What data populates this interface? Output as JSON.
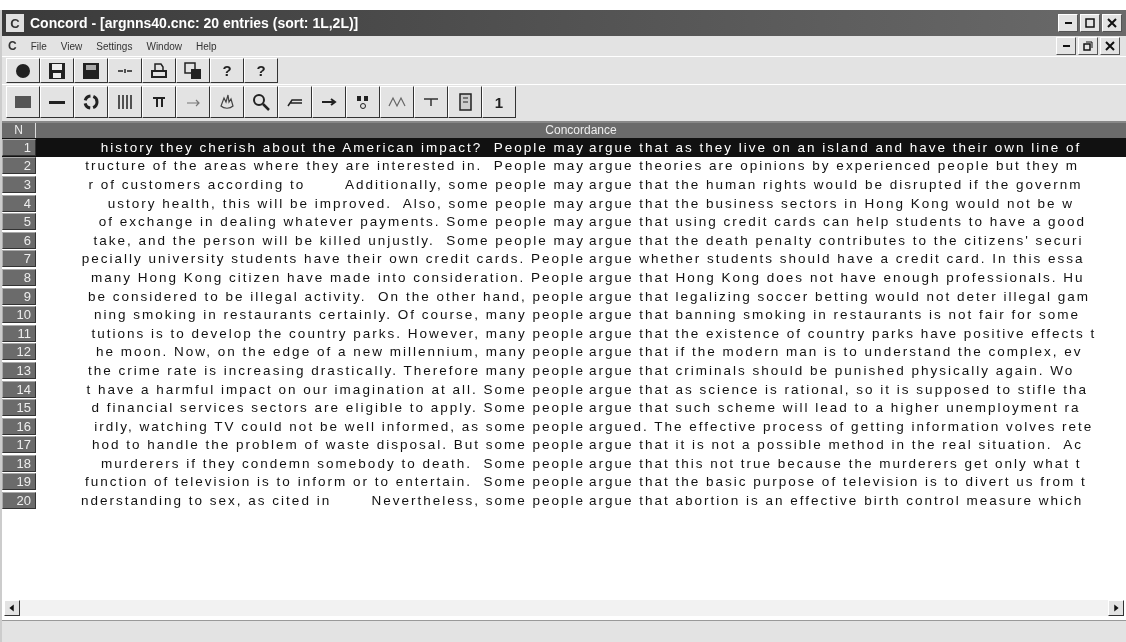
{
  "window": {
    "title": "Concord - [argnns40.cnc: 20 entries (sort: 1L,2L)]",
    "app_icon": "C"
  },
  "menu": {
    "system_icon": "C",
    "items": [
      "File",
      "View",
      "Settings",
      "Window",
      "Help"
    ]
  },
  "toolbars": [
    [
      {
        "kind": "icon"
      },
      {
        "kind": "icon"
      },
      {
        "kind": "icon"
      },
      {
        "kind": "icon"
      },
      {
        "kind": "icon"
      },
      {
        "kind": "icon"
      },
      {
        "kind": "text",
        "label": "?"
      },
      {
        "kind": "text",
        "label": "?"
      }
    ],
    [
      {
        "kind": "icon"
      },
      {
        "kind": "icon"
      },
      {
        "kind": "icon"
      },
      {
        "kind": "icon"
      },
      {
        "kind": "icon"
      },
      {
        "kind": "icon"
      },
      {
        "kind": "icon"
      },
      {
        "kind": "icon"
      },
      {
        "kind": "icon"
      },
      {
        "kind": "icon"
      },
      {
        "kind": "icon"
      },
      {
        "kind": "icon"
      },
      {
        "kind": "icon"
      },
      {
        "kind": "icon"
      },
      {
        "kind": "text",
        "label": "1"
      }
    ]
  ],
  "table": {
    "columns": [
      "N",
      "Concordance"
    ],
    "rows": [
      {
        "n": "1",
        "left": "history they cherish about the American impact?  People may",
        "right": "argue that as they live on an island and have their own line of",
        "selected": true
      },
      {
        "n": "2",
        "left": "tructure of the areas where they are interested in.  People may",
        "right": "argue theories are opinions by experienced people but they m",
        "selected": false
      },
      {
        "n": "3",
        "left": "r of customers according to       Additionally, some people may",
        "right": "argue that the human rights would be disrupted if the governm",
        "selected": false
      },
      {
        "n": "4",
        "left": "ustory health, this will be improved.  Also, some people may",
        "right": "argue that the business sectors in Hong Kong would not be w",
        "selected": false
      },
      {
        "n": "5",
        "left": "of exchange in dealing whatever payments. Some people may",
        "right": "argue that using credit cards can help students to have a good",
        "selected": false
      },
      {
        "n": "6",
        "left": "take, and the person will be killed unjustly.  Some people may",
        "right": "argue that the death penalty contributes to the citizens' securi",
        "selected": false
      },
      {
        "n": "7",
        "left": "pecially university students have their own credit cards. People",
        "right": "argue whether students should have a credit card. In this essa",
        "selected": false
      },
      {
        "n": "8",
        "left": "many Hong Kong citizen have made into consideration. People",
        "right": "argue that Hong Kong does not have enough professionals. Hu",
        "selected": false
      },
      {
        "n": "9",
        "left": "be considered to be illegal activity.  On the other hand, people",
        "right": "argue that legalizing soccer betting would not deter illegal gam",
        "selected": false
      },
      {
        "n": "10",
        "left": "ning smoking in restaurants certainly. Of course, many people",
        "right": "argue that banning smoking in restaurants is not fair for some",
        "selected": false
      },
      {
        "n": "11",
        "left": "tutions is to develop the country parks. However, many people",
        "right": "argue that the existence of country parks have positive effects t",
        "selected": false
      },
      {
        "n": "12",
        "left": "he moon. Now, on the edge of a new millennium, many people",
        "right": "argue that if the modern man is to understand the complex, ev",
        "selected": false
      },
      {
        "n": "13",
        "left": "the crime rate is increasing drastically. Therefore many people",
        "right": "argue that criminals should be punished physically again. Wo",
        "selected": false
      },
      {
        "n": "14",
        "left": "t have a harmful impact on our imagination at all. Some people",
        "right": "argue that as science is rational, so it is supposed to stifle tha",
        "selected": false
      },
      {
        "n": "15",
        "left": "d financial services sectors are eligible to apply. Some people",
        "right": "argue that such scheme will lead to a higher unemployment ra",
        "selected": false
      },
      {
        "n": "16",
        "left": "irdly, watching TV could not be well informed, as some people",
        "right": "argued. The effective process of getting information volves rete",
        "selected": false
      },
      {
        "n": "17",
        "left": "hod to handle the problem of waste disposal. But some people",
        "right": "argue that it is not a possible method in the real situation.  Ac",
        "selected": false
      },
      {
        "n": "18",
        "left": "murderers if they condemn somebody to death.  Some people",
        "right": "argue that this not true because the murderers get only what t",
        "selected": false
      },
      {
        "n": "19",
        "left": "function of television is to inform or to entertain.  Some people",
        "right": "argue that the basic purpose of television is to divert us from t",
        "selected": false
      },
      {
        "n": "20",
        "left": "nderstanding to sex, as cited in       Nevertheless, some people",
        "right": "argue that abortion is an effective birth control measure which",
        "selected": false
      }
    ]
  }
}
